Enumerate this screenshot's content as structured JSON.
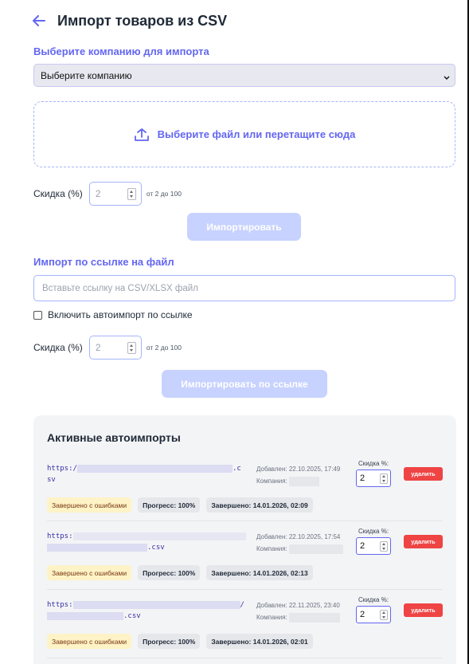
{
  "header": {
    "title": "Импорт товаров из CSV"
  },
  "company": {
    "label": "Выберите компанию для импорта",
    "selected": "Выберите компанию"
  },
  "dropzone": {
    "text": "Выберите файл или перетащите сюда"
  },
  "file_import": {
    "discount_label": "Скидка (%)",
    "discount_value": "2",
    "discount_hint": "от 2 до 100",
    "button": "Импортировать"
  },
  "link_import": {
    "label": "Импорт по ссылке на файл",
    "placeholder": "Вставьте ссылку на CSV/XLSX файл",
    "autoimport_label": "Включить автоимпорт по ссылке",
    "discount_label": "Скидка (%)",
    "discount_value": "2",
    "discount_hint": "от 2 до 100",
    "button": "Импортировать по ссылке"
  },
  "active": {
    "title": "Активные автоимпорты",
    "delete_label": "удалить",
    "discount_label": "Скидка %:",
    "items": [
      {
        "url_start": "https:/",
        "url_line1_end": ".c",
        "url_line2": "sv",
        "added": "Добавлен: 22.10.2025, 17:49",
        "company_label": "Компания:",
        "discount": "2",
        "status": "Завершено с ошибками",
        "progress": "Прогресс: 100%",
        "finished": "Завершено: 14.01.2026, 02:09"
      },
      {
        "url_start": "https:",
        "url_line1_end": "",
        "url_line2": ".csv",
        "added": "Добавлен: 22.10.2025, 17:54",
        "company_label": "Компания:",
        "discount": "2",
        "status": "Завершено с ошибками",
        "progress": "Прогресс: 100%",
        "finished": "Завершено: 14.01.2026, 02:13"
      },
      {
        "url_start": "https:",
        "url_line1_end": "/",
        "url_line2": ".csv",
        "added": "Добавлен: 22.11.2025, 23:40",
        "company_label": "Компания:",
        "discount": "2",
        "status": "Завершено с ошибками",
        "progress": "Прогресс: 100%",
        "finished": "Завершено: 14.01.2026, 02:01"
      }
    ]
  },
  "colors": {
    "accent": "#6366f1",
    "danger": "#ef4444",
    "warning_bg": "#fef3c7"
  }
}
